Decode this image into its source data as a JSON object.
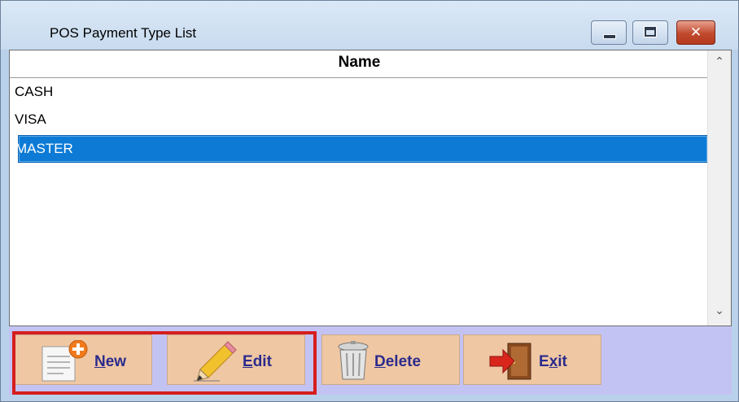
{
  "window": {
    "title": "POS Payment Type List",
    "controls": {
      "minimize": "minimize",
      "maximize": "maximize",
      "close": "✕"
    }
  },
  "grid": {
    "header": "Name",
    "rows": [
      "CASH",
      "VISA",
      "MASTER"
    ],
    "selected_index": 2
  },
  "toolbar": {
    "new": {
      "accel": "N",
      "rest": "ew"
    },
    "edit": {
      "accel": "E",
      "rest": "dit"
    },
    "delete": {
      "accel": "D",
      "rest": "elete"
    },
    "exit": {
      "pre": "E",
      "accel": "x",
      "rest": "it"
    }
  },
  "icons": {
    "new": "document-plus-icon",
    "edit": "pencil-icon",
    "delete": "trash-can-icon",
    "exit": "exit-door-icon"
  },
  "colors": {
    "selection": "#0d7bd6",
    "toolbar_bg": "#c3c3f3",
    "button_bg": "#efc7a3",
    "highlight": "#d61e1e"
  }
}
